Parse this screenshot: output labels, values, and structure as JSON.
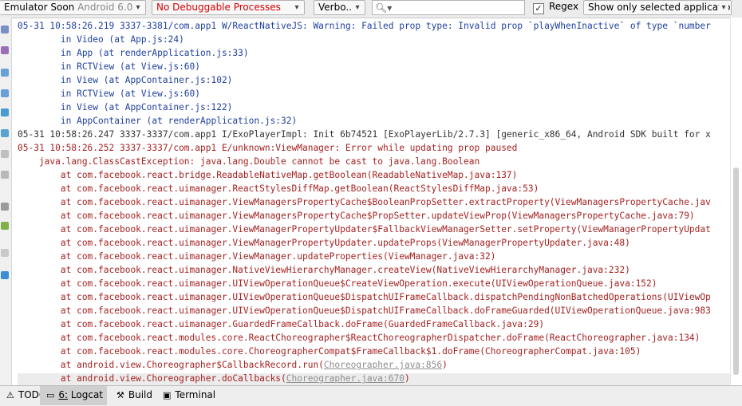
{
  "toolbar": {
    "device_name": "Emulator Soon",
    "device_sub": "Android 6.0,",
    "process": "No Debuggable Processes",
    "log_level": "Verbo...",
    "search_value": "",
    "search_placeholder": "",
    "regex_label": "Regex",
    "regex_checked": true,
    "filter": "Show only selected applicatior"
  },
  "log_lines": [
    {
      "type": "warn",
      "text": "05-31 10:58:26.219 3337-3381/com.app1 W/ReactNativeJS: Warning: Failed prop type: Invalid prop `playWhenInactive` of type `number"
    },
    {
      "type": "warn",
      "text": "        in Video (at App.js:24)"
    },
    {
      "type": "warn",
      "text": "        in App (at renderApplication.js:33)"
    },
    {
      "type": "warn",
      "text": "        in RCTView (at View.js:60)"
    },
    {
      "type": "warn",
      "text": "        in View (at AppContainer.js:102)"
    },
    {
      "type": "warn",
      "text": "        in RCTView (at View.js:60)"
    },
    {
      "type": "warn",
      "text": "        in View (at AppContainer.js:122)"
    },
    {
      "type": "warn",
      "text": "        in AppContainer (at renderApplication.js:32)"
    },
    {
      "type": "info",
      "text": "05-31 10:58:26.247 3337-3337/com.app1 I/ExoPlayerImpl: Init 6b74521 [ExoPlayerLib/2.7.3] [generic_x86_64, Android SDK built for x"
    },
    {
      "type": "err",
      "text": "05-31 10:58:26.252 3337-3337/com.app1 E/unknown:ViewManager: Error while updating prop paused"
    },
    {
      "type": "err",
      "text": "    java.lang.ClassCastException: java.lang.Double cannot be cast to java.lang.Boolean"
    },
    {
      "type": "err",
      "text": "        at com.facebook.react.bridge.ReadableNativeMap.getBoolean(ReadableNativeMap.java:137)"
    },
    {
      "type": "err",
      "text": "        at com.facebook.react.uimanager.ReactStylesDiffMap.getBoolean(ReactStylesDiffMap.java:53)"
    },
    {
      "type": "err",
      "text": "        at com.facebook.react.uimanager.ViewManagersPropertyCache$BooleanPropSetter.extractProperty(ViewManagersPropertyCache.jav"
    },
    {
      "type": "err",
      "text": "        at com.facebook.react.uimanager.ViewManagersPropertyCache$PropSetter.updateViewProp(ViewManagersPropertyCache.java:79)"
    },
    {
      "type": "err",
      "text": "        at com.facebook.react.uimanager.ViewManagerPropertyUpdater$FallbackViewManagerSetter.setProperty(ViewManagerPropertyUpdat"
    },
    {
      "type": "err",
      "text": "        at com.facebook.react.uimanager.ViewManagerPropertyUpdater.updateProps(ViewManagerPropertyUpdater.java:48)"
    },
    {
      "type": "err",
      "text": "        at com.facebook.react.uimanager.ViewManager.updateProperties(ViewManager.java:32)"
    },
    {
      "type": "err",
      "text": "        at com.facebook.react.uimanager.NativeViewHierarchyManager.createView(NativeViewHierarchyManager.java:232)"
    },
    {
      "type": "err",
      "text": "        at com.facebook.react.uimanager.UIViewOperationQueue$CreateViewOperation.execute(UIViewOperationQueue.java:152)"
    },
    {
      "type": "err",
      "text": "        at com.facebook.react.uimanager.UIViewOperationQueue$DispatchUIFrameCallback.dispatchPendingNonBatchedOperations(UIViewOp"
    },
    {
      "type": "err",
      "text": "        at com.facebook.react.uimanager.UIViewOperationQueue$DispatchUIFrameCallback.doFrameGuarded(UIViewOperationQueue.java:983"
    },
    {
      "type": "err",
      "text": "        at com.facebook.react.uimanager.GuardedFrameCallback.doFrame(GuardedFrameCallback.java:29)"
    },
    {
      "type": "err",
      "text": "        at com.facebook.react.modules.core.ReactChoreographer$ReactChoreographerDispatcher.doFrame(ReactChoreographer.java:134)"
    },
    {
      "type": "err",
      "text": "        at com.facebook.react.modules.core.ChoreographerCompat$FrameCallback$1.doFrame(ChoreographerCompat.java:105)"
    },
    {
      "type": "err",
      "text": "        at android.view.Choreographer$CallbackRecord.run(",
      "link": "Choreographer.java:856",
      "tail": ")"
    },
    {
      "type": "err",
      "text": "        at android.view.Choreographer.doCallbacks(",
      "link": "Choreographer.java:670",
      "tail": ")"
    }
  ],
  "bottom_tabs": [
    {
      "label": "TODO",
      "prefix": "",
      "icon": "todo-icon"
    },
    {
      "label": "Logcat",
      "prefix": "6:",
      "icon": "logcat-icon",
      "active": true
    },
    {
      "label": "Build",
      "prefix": "",
      "icon": "build-icon"
    },
    {
      "label": "Terminal",
      "prefix": "",
      "icon": "terminal-icon"
    }
  ],
  "colors": {
    "warn": "#1f3fa0",
    "info": "#333333",
    "error": "#a52222",
    "process_red": "#d40000"
  }
}
